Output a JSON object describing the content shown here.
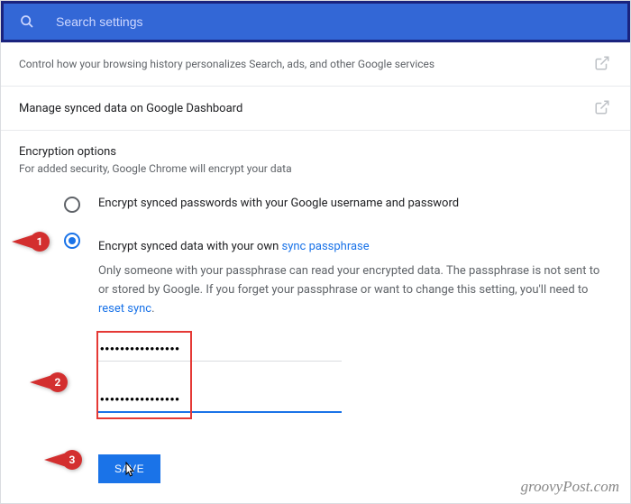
{
  "search": {
    "placeholder": "Search settings"
  },
  "rows": {
    "personalize": "Control how your browsing history personalizes Search, ads, and other Google services",
    "dashboard": "Manage synced data on Google Dashboard"
  },
  "encryption": {
    "title": "Encryption options",
    "subtitle": "For added security, Google Chrome will encrypt your data",
    "opt1": "Encrypt synced passwords with your Google username and password",
    "opt2_pre": "Encrypt synced data with your own ",
    "opt2_link": "sync passphrase",
    "help_pre": "Only someone with your passphrase can read your encrypted data. The passphrase is not sent to or stored by Google. If you forget your passphrase or want to change this setting, you'll need to ",
    "help_link": "reset sync",
    "help_post": "."
  },
  "passfields": {
    "f1": "••••••••••••••••",
    "f2": "••••••••••••••••"
  },
  "buttons": {
    "save": "SAVE"
  },
  "badges": {
    "b1": "1",
    "b2": "2",
    "b3": "3"
  },
  "watermark": "groovyPost.com"
}
